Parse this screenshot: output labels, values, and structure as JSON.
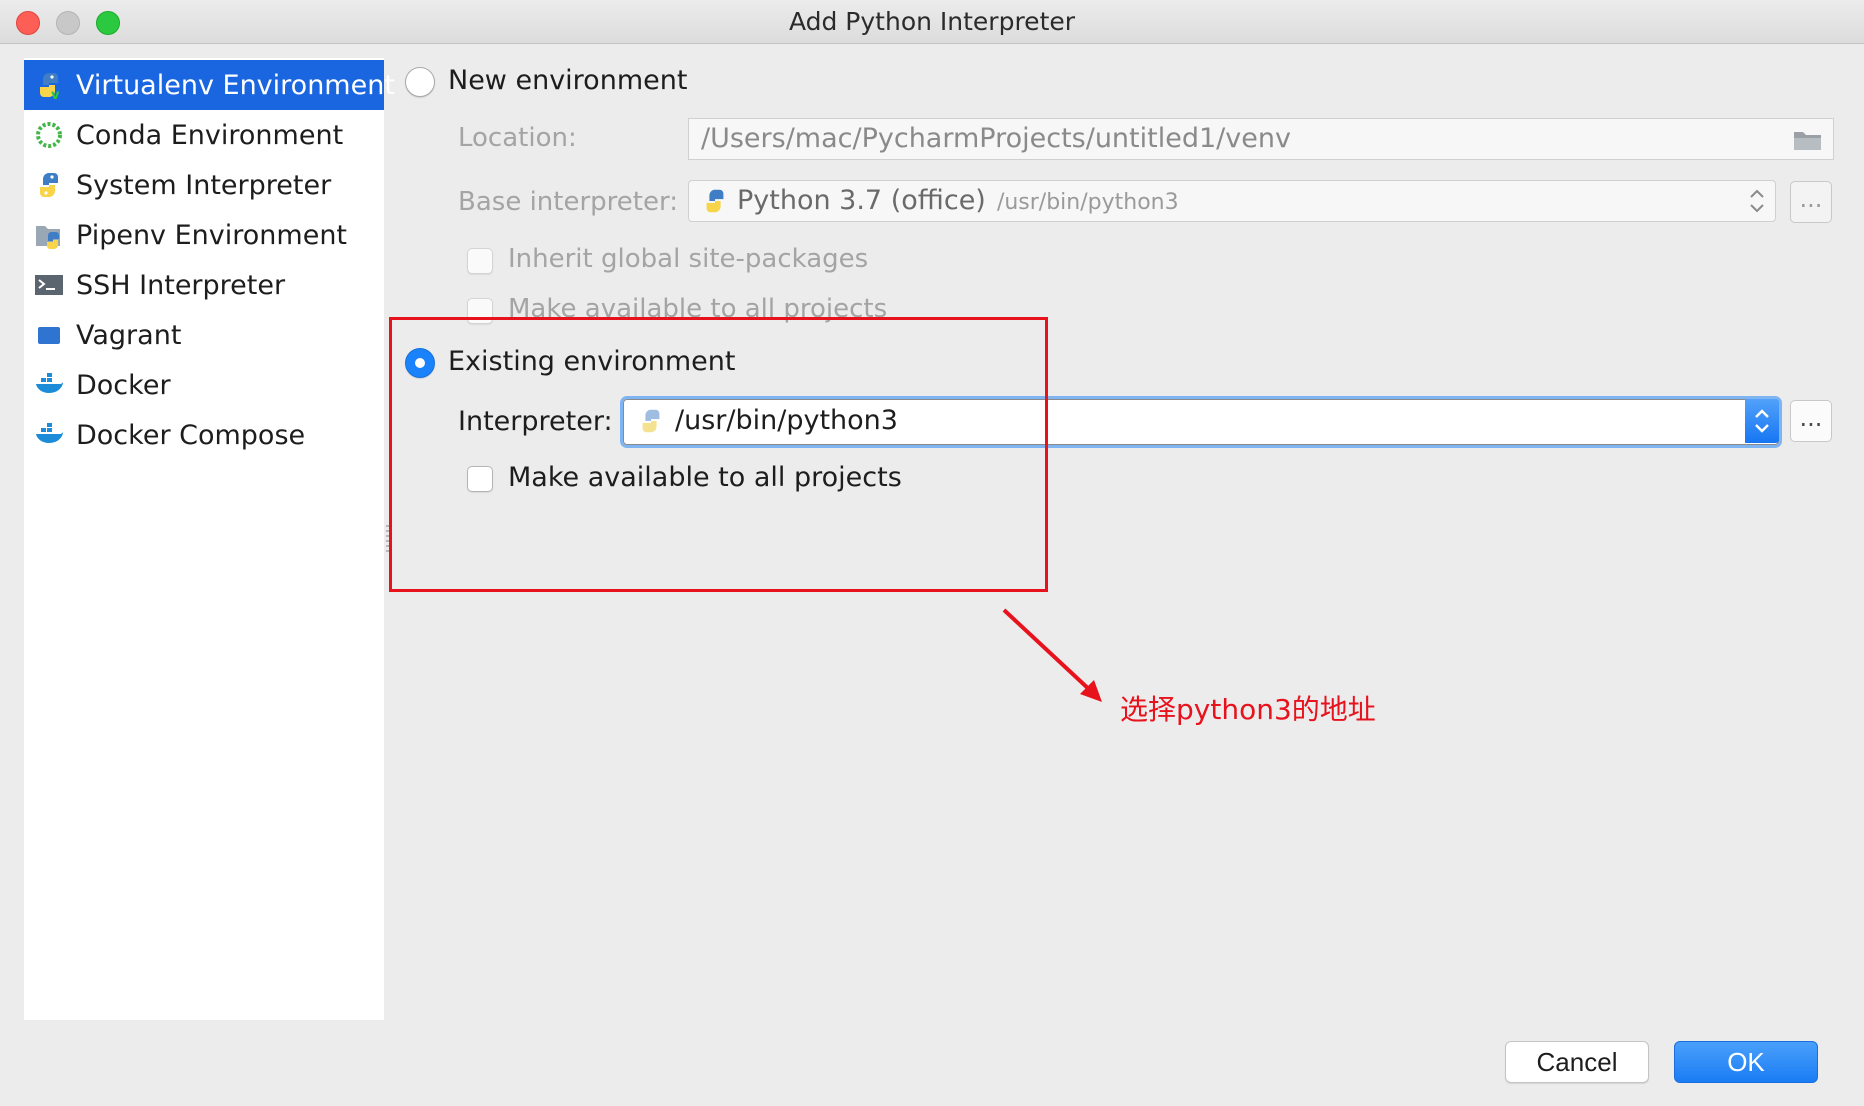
{
  "window": {
    "title": "Add Python Interpreter"
  },
  "sidebar": {
    "items": [
      {
        "label": "Virtualenv Environment",
        "icon": "virtualenv-icon",
        "selected": true
      },
      {
        "label": "Conda Environment",
        "icon": "conda-icon"
      },
      {
        "label": "System Interpreter",
        "icon": "python-icon"
      },
      {
        "label": "Pipenv Environment",
        "icon": "pipenv-icon"
      },
      {
        "label": "SSH Interpreter",
        "icon": "terminal-icon"
      },
      {
        "label": "Vagrant",
        "icon": "vagrant-icon"
      },
      {
        "label": "Docker",
        "icon": "docker-icon"
      },
      {
        "label": "Docker Compose",
        "icon": "docker-compose-icon"
      }
    ]
  },
  "new_env": {
    "label": "New environment",
    "location_label": "Location:",
    "location_value": "/Users/mac/PycharmProjects/untitled1/venv",
    "base_label": "Base interpreter:",
    "base_name": "Python 3.7 (office)",
    "base_path": "/usr/bin/python3",
    "inherit_label": "Inherit global site-packages",
    "make_available_label": "Make available to all projects",
    "ellipsis": "..."
  },
  "existing_env": {
    "label": "Existing environment",
    "interpreter_label": "Interpreter:",
    "interpreter_value": "/usr/bin/python3",
    "make_available_label": "Make available to all projects",
    "ellipsis": "..."
  },
  "annotation": {
    "text": "选择python3的地址",
    "color": "#e8121c"
  },
  "buttons": {
    "cancel": "Cancel",
    "ok": "OK"
  },
  "colors": {
    "accent": "#1a66e0",
    "ok_button": "#1a7cf4",
    "annotation": "#e8121c"
  }
}
